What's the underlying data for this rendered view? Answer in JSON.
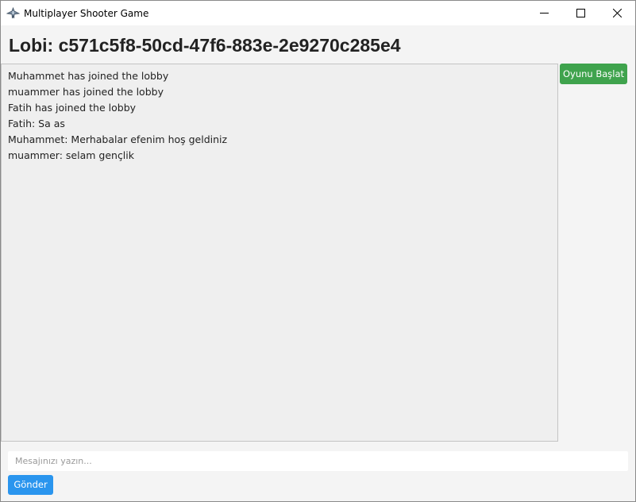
{
  "window": {
    "title": "Multiplayer Shooter Game",
    "app_icon": "spaceship-icon",
    "controls": {
      "minimize_icon": "minimize-icon",
      "maximize_icon": "maximize-icon",
      "close_icon": "close-icon"
    }
  },
  "lobby": {
    "title": "Lobi: c571c5f8-50cd-47f6-883e-2e9270c285e4",
    "start_button": "Oyunu Başlat"
  },
  "chat": {
    "messages": [
      "Muhammet has joined the lobby",
      "muammer has joined the lobby",
      "Fatih has joined the lobby",
      "Fatih: Sa as",
      "Muhammet: Merhabalar efenim hoş geldiniz",
      "muammer: selam gençlik"
    ],
    "input_placeholder": "Mesajınızı yazın...",
    "input_value": "",
    "send_button": "Gönder"
  },
  "colors": {
    "start_button": "#3fa34d",
    "send_button": "#2a95ee",
    "background": "#f4f4f4"
  }
}
